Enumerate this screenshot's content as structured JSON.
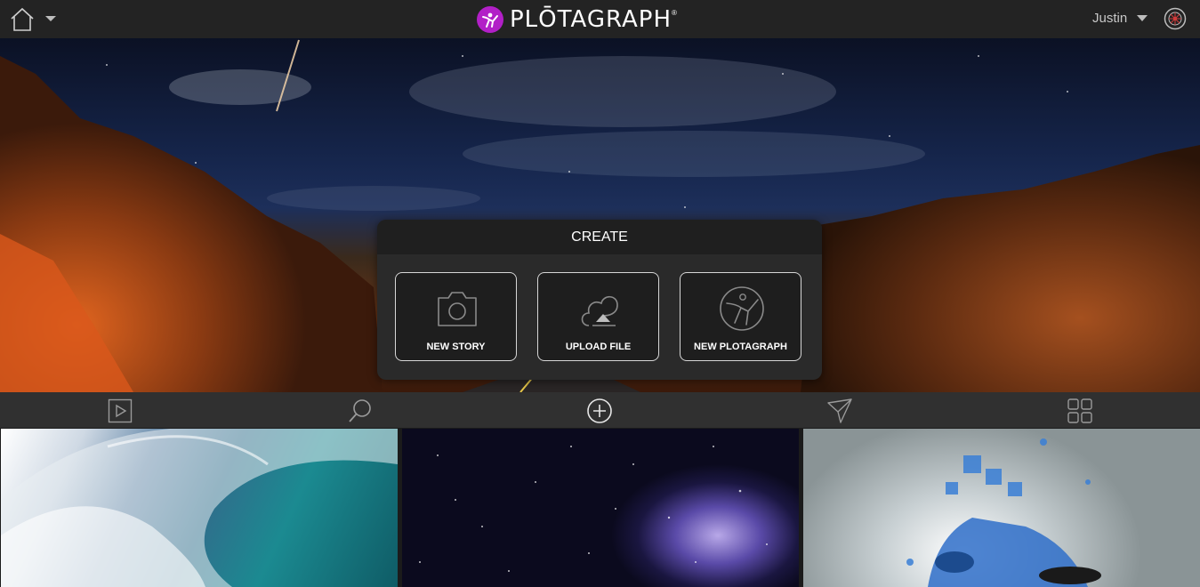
{
  "app": {
    "brand": "PLŌTAGRAPH",
    "brand_mark": "®"
  },
  "header": {
    "home_icon": "home-icon",
    "user_name": "Justin",
    "settings_icon": "settings-icon"
  },
  "create_panel": {
    "title": "CREATE",
    "tiles": [
      {
        "label": "NEW STORY",
        "icon": "camera-icon"
      },
      {
        "label": "UPLOAD FILE",
        "icon": "upload-cloud-icon"
      },
      {
        "label": "NEW PLOTAGRAPH",
        "icon": "plotagraph-logo-icon"
      }
    ]
  },
  "nav": {
    "items": [
      {
        "icon": "play-icon"
      },
      {
        "icon": "search-icon"
      },
      {
        "icon": "add-icon"
      },
      {
        "icon": "send-icon"
      },
      {
        "icon": "grid-icon"
      }
    ]
  },
  "gallery": {
    "items": [
      {
        "subject": "ocean-wave"
      },
      {
        "subject": "galaxy"
      },
      {
        "subject": "scooter"
      }
    ]
  },
  "colors": {
    "brand_accent": "#b21fc7",
    "topbar": "#232323",
    "navbar": "#303030",
    "panel": "#2a2a2a"
  }
}
